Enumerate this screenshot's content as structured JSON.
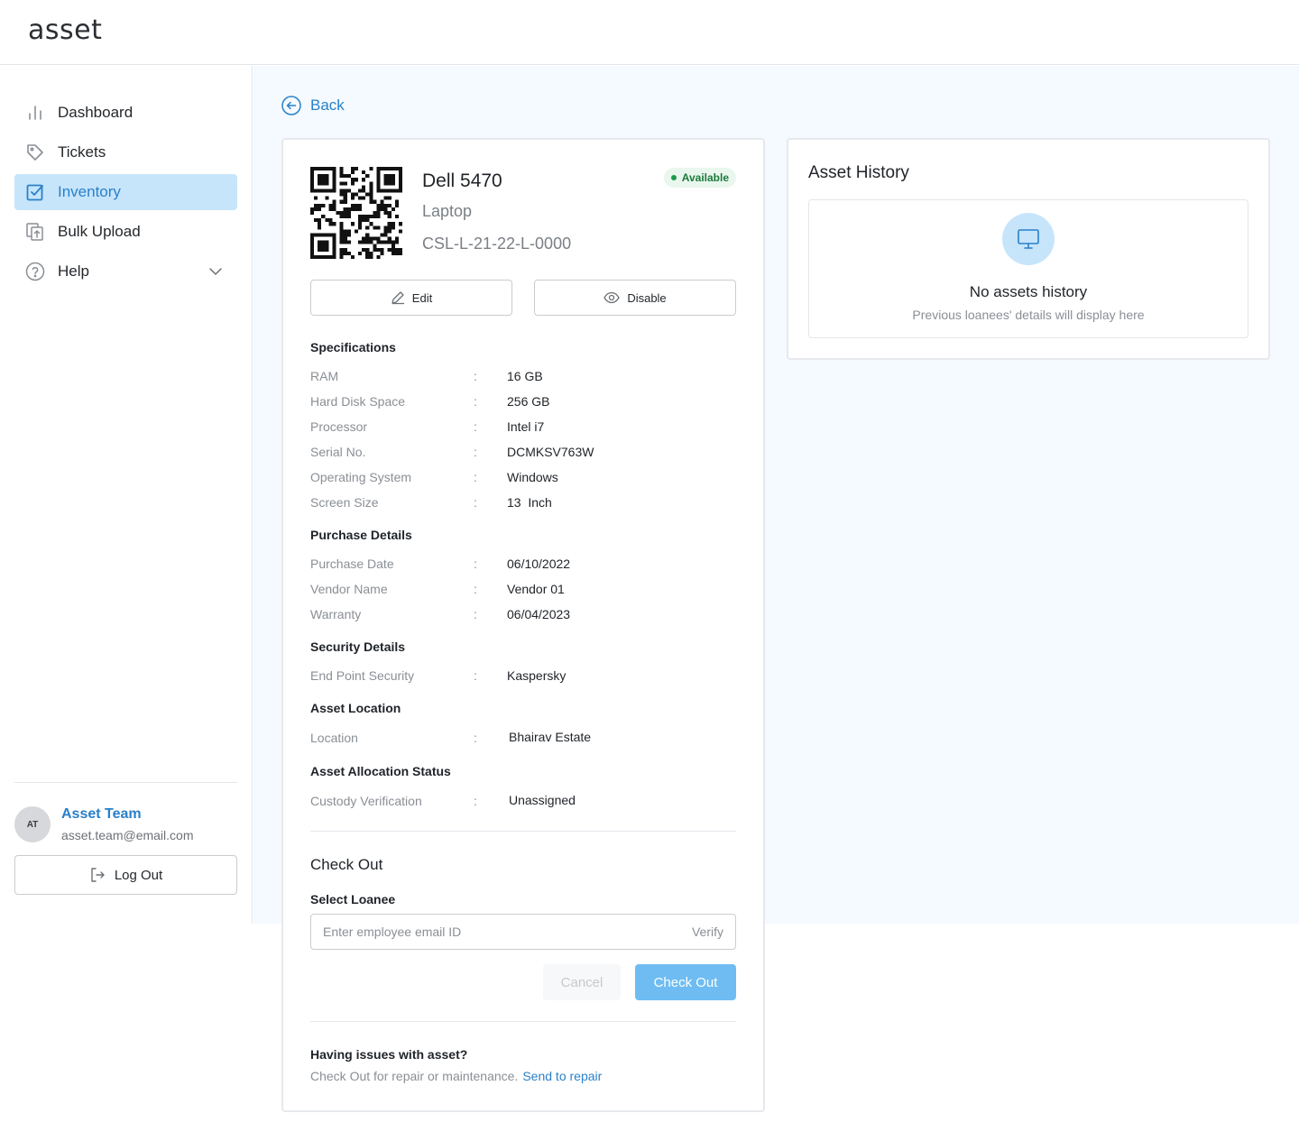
{
  "app": {
    "logo": "asset"
  },
  "sidebar": {
    "items": [
      {
        "label": "Dashboard",
        "icon": "bar-chart-icon"
      },
      {
        "label": "Tickets",
        "icon": "tag-icon"
      },
      {
        "label": "Inventory",
        "icon": "checkbox-icon",
        "active": true
      },
      {
        "label": "Bulk Upload",
        "icon": "upload-icon"
      },
      {
        "label": "Help",
        "icon": "question-icon",
        "expandable": true
      }
    ],
    "user": {
      "initials": "AT",
      "name": "Asset Team",
      "email": "asset.team@email.com"
    },
    "logout_label": "Log Out"
  },
  "back_label": "Back",
  "asset": {
    "name": "Dell 5470",
    "type": "Laptop",
    "code": "CSL-L-21-22-L-0000",
    "status": "Available",
    "edit_label": "Edit",
    "disable_label": "Disable",
    "sections": {
      "specifications": {
        "title": "Specifications",
        "rows": [
          {
            "label": "RAM",
            "value": "16 GB"
          },
          {
            "label": "Hard Disk Space",
            "value": "256 GB"
          },
          {
            "label": "Processor",
            "value": "Intel i7"
          },
          {
            "label": "Serial No.",
            "value": "DCMKSV763W"
          },
          {
            "label": "Operating System",
            "value": "Windows"
          },
          {
            "label": "Screen Size",
            "value": "13  Inch"
          }
        ]
      },
      "purchase": {
        "title": "Purchase Details",
        "rows": [
          {
            "label": "Purchase Date",
            "value": "06/10/2022"
          },
          {
            "label": "Vendor Name",
            "value": "Vendor 01"
          },
          {
            "label": "Warranty",
            "value": "06/04/2023"
          }
        ]
      },
      "security": {
        "title": "Security Details",
        "rows": [
          {
            "label": "End Point Security",
            "value": "Kaspersky"
          }
        ]
      },
      "location": {
        "title": "Asset Location",
        "rows": [
          {
            "label": "Location",
            "value": "Bhairav Estate"
          }
        ]
      },
      "allocation": {
        "title": "Asset Allocation Status",
        "rows": [
          {
            "label": "Custody Verification",
            "value": "Unassigned"
          }
        ]
      }
    },
    "colon": ":"
  },
  "checkout": {
    "title": "Check Out",
    "select_label": "Select Loanee",
    "email_placeholder": "Enter employee email ID",
    "email_value": "",
    "verify_label": "Verify",
    "cancel_label": "Cancel",
    "submit_label": "Check Out"
  },
  "issues": {
    "title": "Having issues with asset?",
    "text": "Check Out for repair or maintenance.",
    "link": "Send to repair"
  },
  "history": {
    "title": "Asset History",
    "empty_title": "No assets history",
    "empty_subtitle": "Previous loanees' details will display here",
    "icon": "monitor-icon"
  },
  "colors": {
    "accent": "#2a80c9",
    "active_bg": "#c6e5fb",
    "primary_button": "#6ebcf2",
    "status_green": "#1d9a4b"
  }
}
